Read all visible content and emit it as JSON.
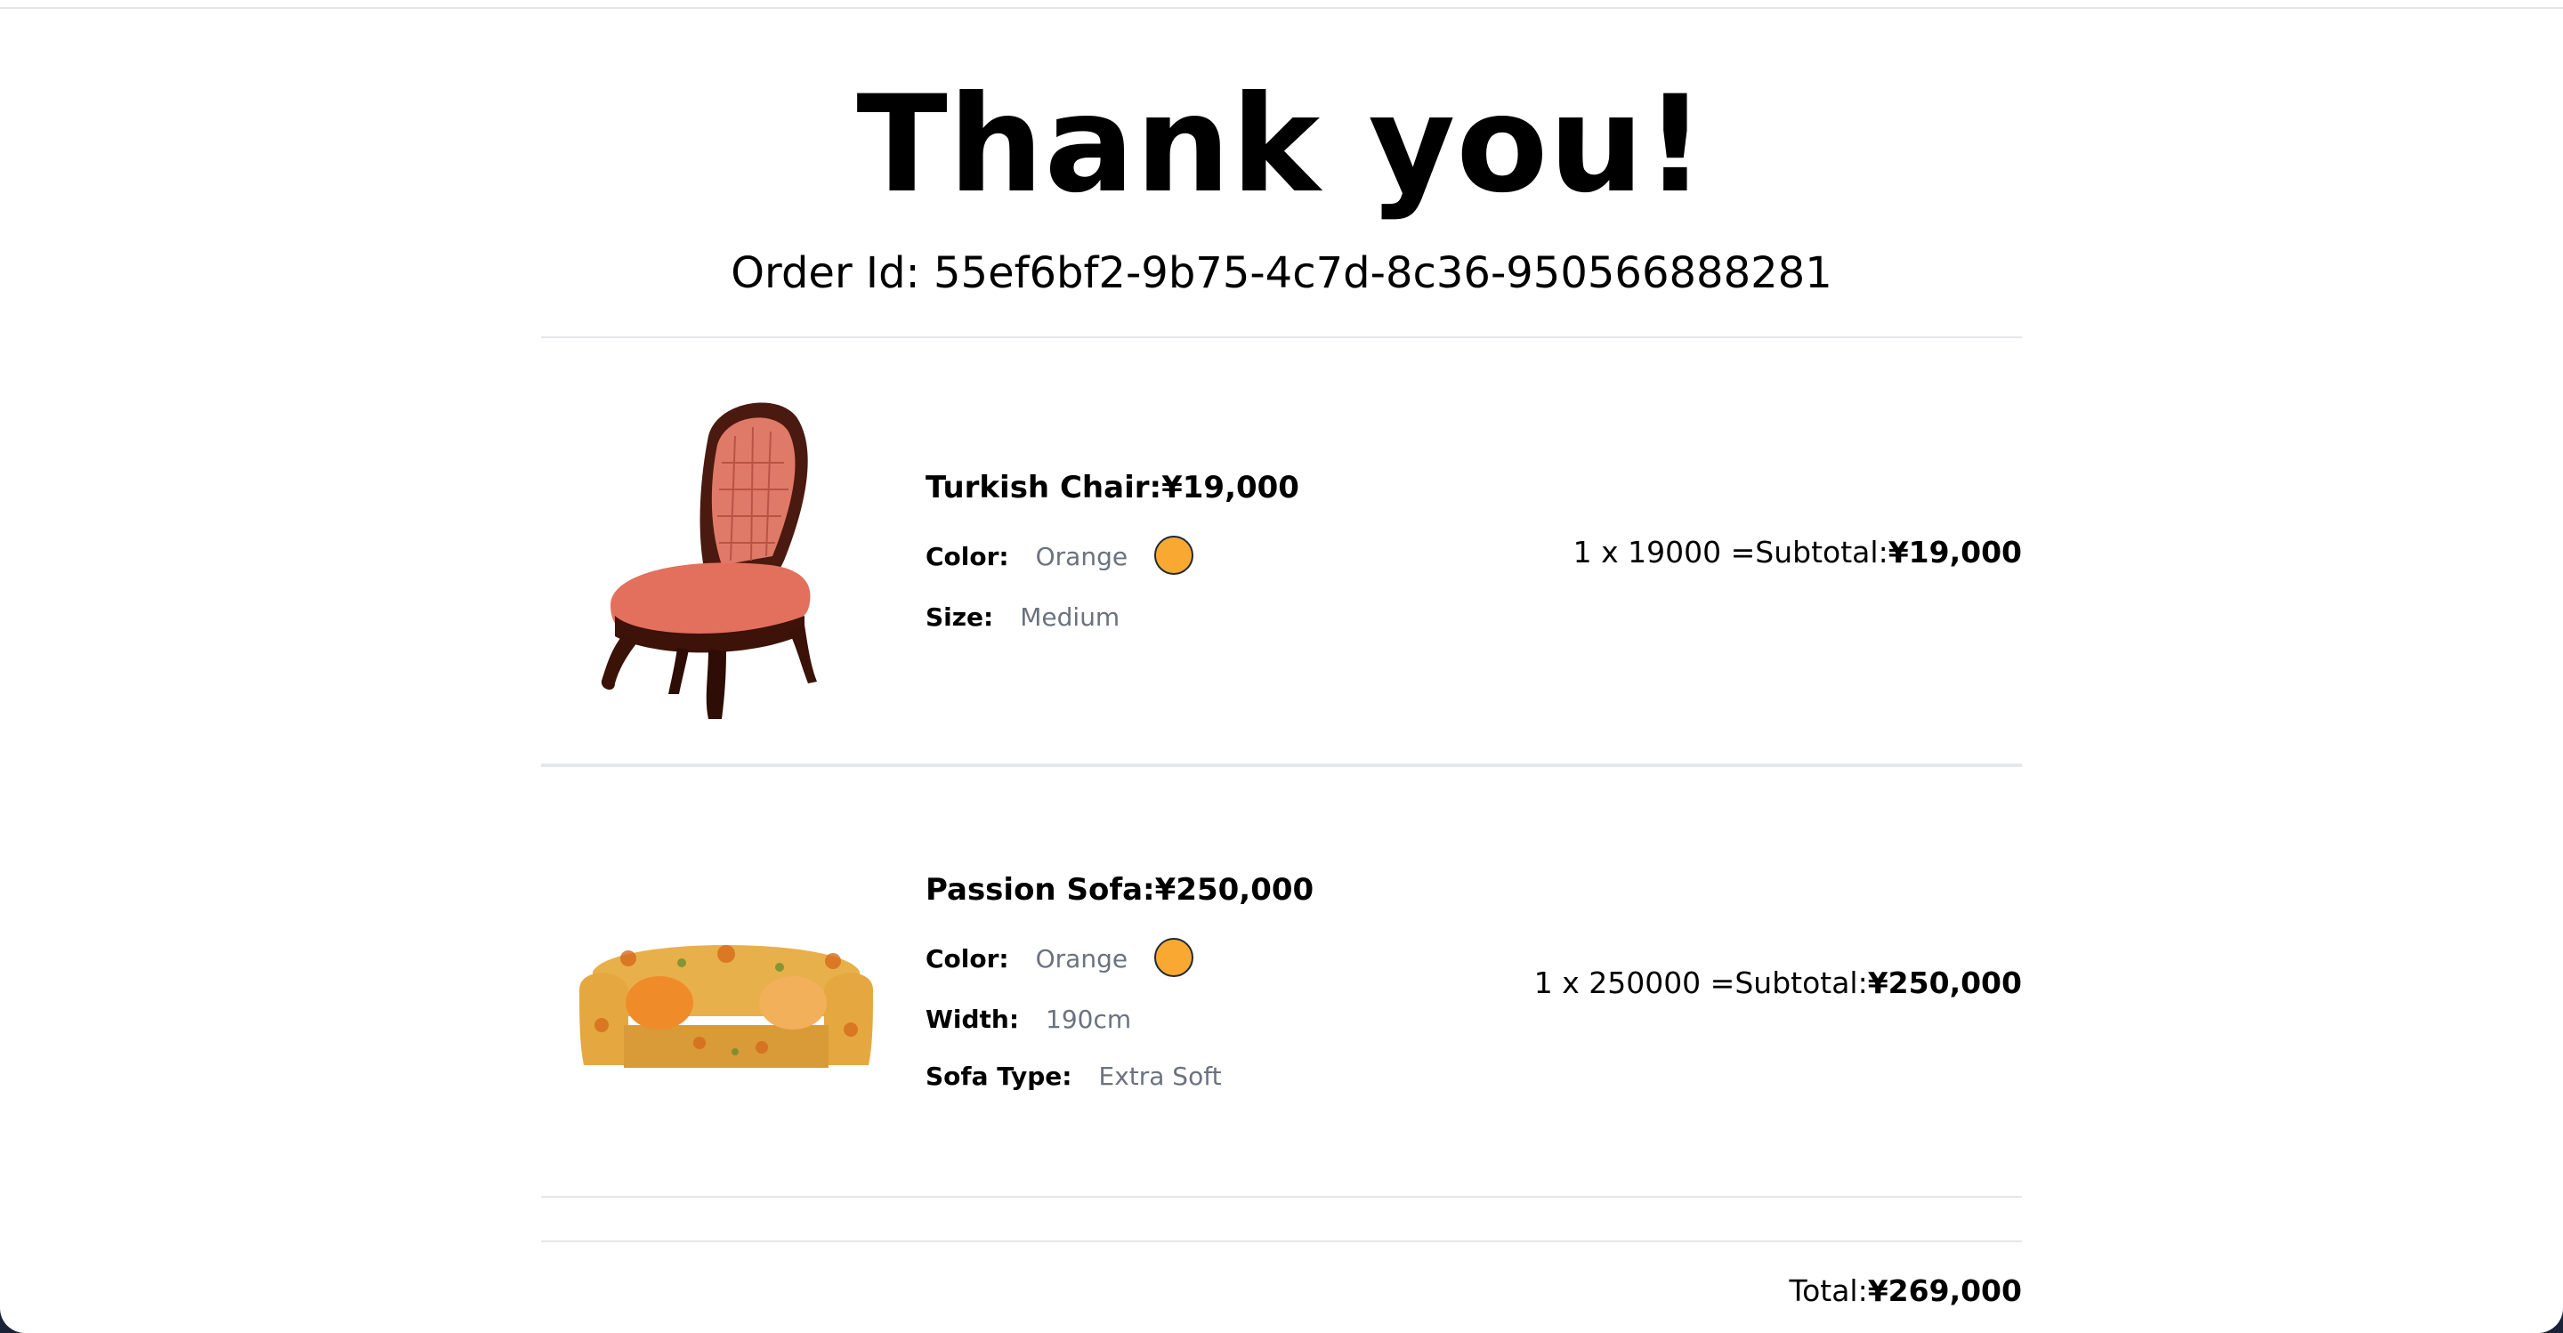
{
  "page": {
    "title": "Thank you!",
    "order_id_label": "Order Id:",
    "order_id": "55ef6bf2-9b75-4c7d-8c36-950566888281"
  },
  "items": [
    {
      "name": "Turkish Chair:",
      "price": "¥19,000",
      "image": "turkish-chair-image",
      "attributes": [
        {
          "label": "Color:",
          "value": "Orange",
          "swatch_color": "#f9a931"
        },
        {
          "label": "Size:",
          "value": "Medium"
        }
      ],
      "quantity_line": "1 x 19000 =",
      "subtotal_label": "Subtotal:",
      "subtotal": "¥19,000"
    },
    {
      "name": "Passion Sofa:",
      "price": "¥250,000",
      "image": "passion-sofa-image",
      "attributes": [
        {
          "label": "Color:",
          "value": "Orange",
          "swatch_color": "#f9a931"
        },
        {
          "label": "Width:",
          "value": "190cm"
        },
        {
          "label": "Sofa Type:",
          "value": "Extra Soft"
        }
      ],
      "quantity_line": "1 x 250000 =",
      "subtotal_label": "Subtotal:",
      "subtotal": "¥250,000"
    }
  ],
  "summary": {
    "total_label": "Total:",
    "total": "¥269,000"
  },
  "colors": {
    "swatch_orange": "#f9a931",
    "divider": "#e5e7eb",
    "muted_text": "#6b7280"
  }
}
